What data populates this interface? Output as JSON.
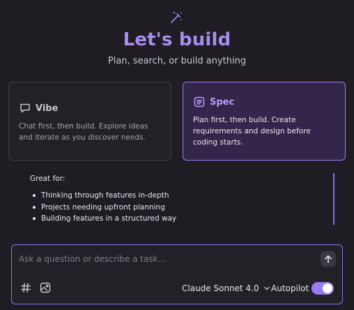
{
  "header": {
    "icon": "magic-wand-icon",
    "title": "Let's build",
    "subtitle": "Plan, search, or build anything"
  },
  "modes": {
    "vibe": {
      "icon": "chat-bubble-icon",
      "title": "Vibe",
      "description": "Chat first, then build. Explore ideas and iterate as you discover needs.",
      "selected": false
    },
    "spec": {
      "icon": "document-list-icon",
      "title": "Spec",
      "description": "Plan first, then build. Create requirements and design before coding starts.",
      "selected": true
    }
  },
  "details": {
    "heading": "Great for:",
    "items": [
      "Thinking through features in-depth",
      "Projects needing upfront planning",
      "Building features in a structured way"
    ]
  },
  "composer": {
    "placeholder": "Ask a question or describe a task...",
    "value": "",
    "send_icon": "arrow-up-icon",
    "context_icon": "hash-icon",
    "image_icon": "image-upload-icon",
    "model": "Claude Sonnet 4.0",
    "autopilot_label": "Autopilot",
    "autopilot_on": true
  },
  "colors": {
    "accent": "#a98cf2",
    "background": "#1f1d23",
    "selected_card": "#33264a"
  }
}
